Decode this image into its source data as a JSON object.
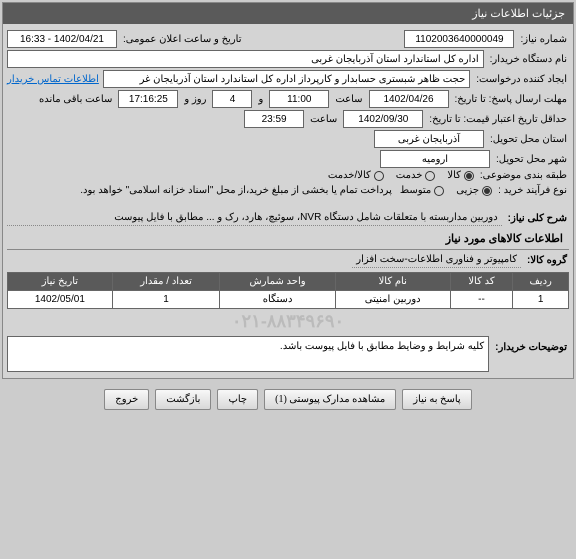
{
  "header": {
    "title": "جزئیات اطلاعات نیاز"
  },
  "fields": {
    "no_label": "شماره نیاز:",
    "no_value": "1102003640000049",
    "pubdate_label": "تاریخ و ساعت اعلان عمومی:",
    "pubdate_value": "1402/04/21 - 16:33",
    "buyer_label": "نام دستگاه خریدار:",
    "buyer_value": "اداره کل استاندارد استان آذربایجان غربی",
    "creator_label": "ایجاد کننده درخواست:",
    "creator_value": "حجت ظاهر شبستری حسابدار و کارپرداز اداره کل استاندارد استان آذربایجان غر",
    "contact_link": "اطلاعات تماس خریدار",
    "deadline_label": "مهلت ارسال پاسخ: تا تاریخ:",
    "deadline_date": "1402/04/26",
    "time_label": "ساعت",
    "deadline_time": "11:00",
    "and_label": "و",
    "days_value": "4",
    "day_label": "روز و",
    "countdown": "17:16:25",
    "remaining": "ساعت باقی مانده",
    "validity_label": "حداقل تاریخ اعتبار قیمت: تا تاریخ:",
    "validity_date": "1402/09/30",
    "validity_time": "23:59",
    "province_label": "استان محل تحویل:",
    "province_value": "آذربایجان غربی",
    "city_label": "شهر محل تحویل:",
    "city_value": "ارومیه",
    "category_label": "طبقه بندی موضوعی:",
    "cat_goods": "کالا",
    "cat_service": "خدمت",
    "cat_both": "کالا/خدمت",
    "process_label": "نوع فرآیند خرید :",
    "proc_low": "جزیی",
    "proc_med": "متوسط",
    "payment_note": "پرداخت تمام یا بخشی از مبلغ خرید،از محل \"اسناد خزانه اسلامی\" خواهد بود."
  },
  "desc": {
    "label": "شرح کلی نیاز:",
    "value": "دوربین مداربسته با متعلقات شامل دستگاه NVR، سوئیچ، هارد، رک و ... مطابق با فایل پیوست"
  },
  "goods": {
    "title": "اطلاعات کالاهای مورد نیاز",
    "group_label": "گروه کالا:",
    "group_value": "کامپیوتر و فناوری اطلاعات-سخت افزار",
    "headers": {
      "row": "ردیف",
      "code": "کد کالا",
      "name": "نام کالا",
      "unit": "واحد شمارش",
      "qty": "تعداد / مقدار",
      "date": "تاریخ نیاز"
    },
    "rows": [
      {
        "row": "1",
        "code": "--",
        "name": "دوربین امنیتی",
        "unit": "دستگاه",
        "qty": "1",
        "date": "1402/05/01"
      }
    ]
  },
  "notes": {
    "label": "توضیحات خریدار:",
    "value": "کلیه شرایط و وضایط مطابق با فایل پیوست باشد."
  },
  "phone": "۰۲۱-۸۸۳۴۹۶۹۰",
  "buttons": {
    "reply": "پاسخ به نیاز",
    "attach": "مشاهده مدارک پیوستی (1)",
    "print": "چاپ",
    "back": "بازگشت",
    "exit": "خروج"
  }
}
